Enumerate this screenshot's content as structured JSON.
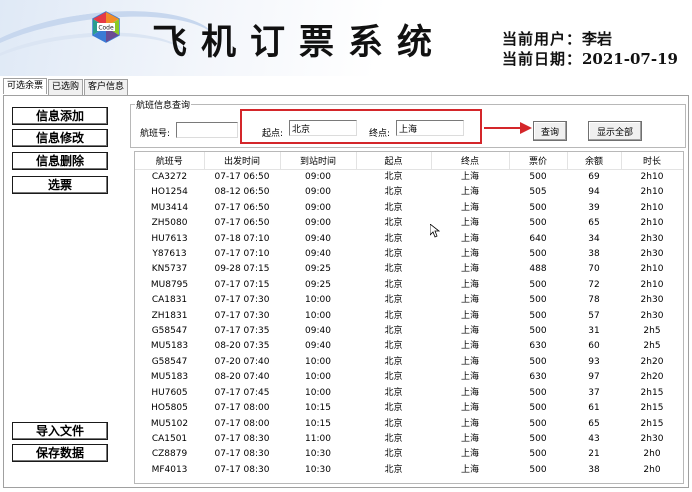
{
  "header": {
    "title": "飞机订票系统",
    "logo_text": "Code",
    "user_label": "当前用户：",
    "user_name": "李岩",
    "date_label": "当前日期：",
    "date_value": "2021-07-19"
  },
  "tabs": [
    {
      "label": "可选余票",
      "active": true
    },
    {
      "label": "已选购",
      "active": false
    },
    {
      "label": "客户信息",
      "active": false
    }
  ],
  "left_buttons": {
    "add": "信息添加",
    "modify": "信息修改",
    "delete": "信息删除",
    "select": "选票",
    "import": "导入文件",
    "save": "保存数据"
  },
  "query": {
    "legend": "航班信息查询",
    "flight_no_label": "航班号:",
    "flight_no_value": "",
    "origin_label": "起点:",
    "origin_value": "北京",
    "dest_label": "终点:",
    "dest_value": "上海",
    "search_button": "查询",
    "show_all_button": "显示全部"
  },
  "colors": {
    "highlight_border": "#d4262a",
    "arrow": "#d4262a"
  },
  "table": {
    "columns": [
      "航班号",
      "出发时间",
      "到站时间",
      "起点",
      "终点",
      "票价",
      "余额",
      "时长"
    ],
    "rows": [
      [
        "CA3272",
        "07-17 06:50",
        "09:00",
        "北京",
        "上海",
        "500",
        "69",
        "2h10"
      ],
      [
        "HO1254",
        "08-12 06:50",
        "09:00",
        "北京",
        "上海",
        "505",
        "94",
        "2h10"
      ],
      [
        "MU3414",
        "07-17 06:50",
        "09:00",
        "北京",
        "上海",
        "500",
        "39",
        "2h10"
      ],
      [
        "ZH5080",
        "07-17 06:50",
        "09:00",
        "北京",
        "上海",
        "500",
        "65",
        "2h10"
      ],
      [
        "HU7613",
        "07-18 07:10",
        "09:40",
        "北京",
        "上海",
        "640",
        "34",
        "2h30"
      ],
      [
        "Y87613",
        "07-17 07:10",
        "09:40",
        "北京",
        "上海",
        "500",
        "38",
        "2h30"
      ],
      [
        "KN5737",
        "09-28 07:15",
        "09:25",
        "北京",
        "上海",
        "488",
        "70",
        "2h10"
      ],
      [
        "MU8795",
        "07-17 07:15",
        "09:25",
        "北京",
        "上海",
        "500",
        "72",
        "2h10"
      ],
      [
        "CA1831",
        "07-17 07:30",
        "10:00",
        "北京",
        "上海",
        "500",
        "78",
        "2h30"
      ],
      [
        "ZH1831",
        "07-17 07:30",
        "10:00",
        "北京",
        "上海",
        "500",
        "57",
        "2h30"
      ],
      [
        "G58547",
        "07-17 07:35",
        "09:40",
        "北京",
        "上海",
        "500",
        "31",
        "2h5"
      ],
      [
        "MU5183",
        "08-20 07:35",
        "09:40",
        "北京",
        "上海",
        "630",
        "60",
        "2h5"
      ],
      [
        "G58547",
        "07-20 07:40",
        "10:00",
        "北京",
        "上海",
        "500",
        "93",
        "2h20"
      ],
      [
        "MU5183",
        "08-20 07:40",
        "10:00",
        "北京",
        "上海",
        "630",
        "97",
        "2h20"
      ],
      [
        "HU7605",
        "07-17 07:45",
        "10:00",
        "北京",
        "上海",
        "500",
        "37",
        "2h15"
      ],
      [
        "HO5805",
        "07-17 08:00",
        "10:15",
        "北京",
        "上海",
        "500",
        "61",
        "2h15"
      ],
      [
        "MU5102",
        "07-17 08:00",
        "10:15",
        "北京",
        "上海",
        "500",
        "65",
        "2h15"
      ],
      [
        "CA1501",
        "07-17 08:30",
        "11:00",
        "北京",
        "上海",
        "500",
        "43",
        "2h30"
      ],
      [
        "CZ8879",
        "07-17 08:30",
        "10:30",
        "北京",
        "上海",
        "500",
        "21",
        "2h0"
      ],
      [
        "MF4013",
        "07-17 08:30",
        "10:30",
        "北京",
        "上海",
        "500",
        "38",
        "2h0"
      ]
    ]
  }
}
